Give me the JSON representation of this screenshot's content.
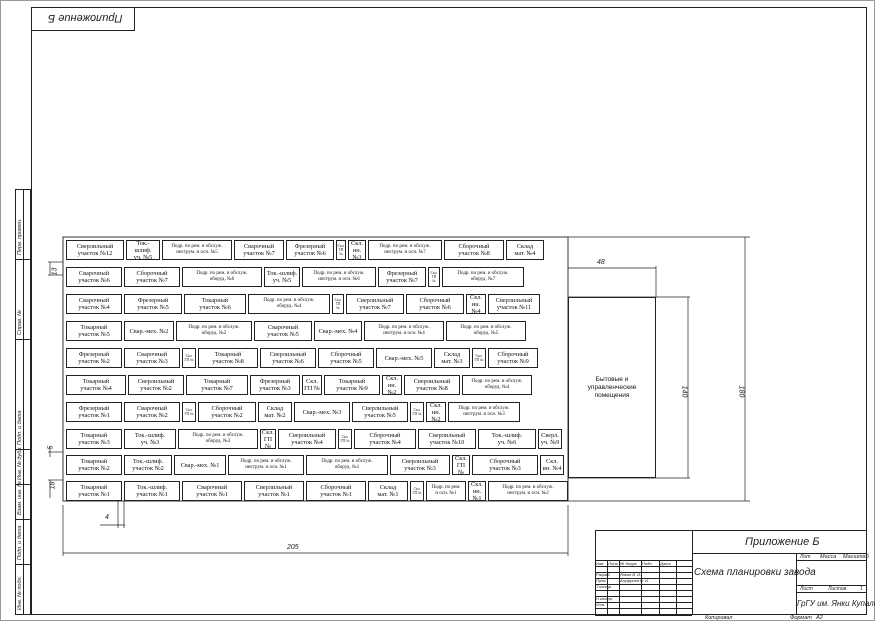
{
  "sheet_header": "Приложение Б",
  "top_stamp": "Приложение Б",
  "title_block": {
    "appendix": "Приложение Б",
    "drawing_title": "Схема планировки завода",
    "organization": "ГрГУ им. Янки Купалы",
    "col_lit": "Лит",
    "col_mass": "Масса",
    "col_scale": "Масштаб",
    "sheet": "Лист",
    "sheets": "Листов",
    "sheets_value": "1",
    "copied": "Копировал",
    "format": "Формат",
    "format_value": "А2",
    "change_headers": [
      "Изм",
      "Лист",
      "№ докум.",
      "Подп.",
      "Дата"
    ],
    "roles": [
      "Разраб.",
      "Пров.",
      "Т.контр.",
      "",
      "Н.контр.",
      "Утв."
    ],
    "people": [
      "Янкин В. И.",
      "Ануфриев В. И."
    ]
  },
  "side_stamp": [
    "Перв. примен.",
    "Справ. №",
    "Подп. и дата",
    "Инв. № дубл.",
    "Взам. инв. №",
    "Подп. и дата",
    "Инв. № подл."
  ],
  "dimensions": {
    "total_width": "205",
    "right_width": "48",
    "height_inner": "140",
    "height_outer": "180",
    "row_height": "13",
    "cell_gap": "4",
    "small_gap": "5",
    "bottom_row": "18"
  },
  "side_building": "Бытовые и\nуправленческие\nпомещения",
  "rows": [
    [
      "Сверлильный\nучасток №12",
      "Ток.-шлиф.\nуч. №5",
      "Подр. по рем. и обслуж.\nинструм. и осн. №5",
      "Сварочный\nучасток №7",
      "Фрезерный\nучасток №6",
      "Скл.\nГП №",
      "Скл.\nин. №3",
      "Подр. по рем. и обслуж.\nинструм. и осн. №7",
      "Сборочный\nучасток №8",
      "Склад\nмат. №4"
    ],
    [
      "Сварочный\nучасток №6",
      "Сборочный\nучасток №7",
      "Подр. по рем. и обслуж.\nоборуд. №6",
      "Ток.-шлиф.\nуч. №5",
      "Подр. по рем. и обслуж.\nинструм. и осн. №6",
      "Фрезерный\nучасток №7",
      "Скл.\nГП №",
      "Подр. по рем. и обслуж.\nоборуд. №7"
    ],
    [
      "Сварочный\nучасток №4",
      "Фрезерный\nучасток №5",
      "Токарный\nучасток №6",
      "Подр. по рем. и обслуж.\nоборуд. №4",
      "Скл.\nГП №",
      "Сверлильный\nучасток №7",
      "Сборочный\nучасток №6",
      "Скл.\nин. №4",
      "Сверлильный\nучасток №11"
    ],
    [
      "Токарный\nучасток №5",
      "Свар.-мех. №2",
      "Подр. по рем. и обслуж.\nоборуд. №2",
      "Сварочный\nучасток №5",
      "Свар.-мех. №4",
      "Подр. по рем. и обслуж.\nинструм. и осн. №4",
      "Подр. по рем. и обслуж.\nоборуд. №5"
    ],
    [
      "Фрезерный\nучасток №2",
      "Сварочный\nучасток №3",
      "Скл.\nГП №",
      "Токарный\nучасток №8",
      "Сверлильный\nучасток №6",
      "Сборочный\nучасток №5",
      "Свар.-мех. №5",
      "Склад\nмат. №3",
      "Скл.\nГП №",
      "Сборочный\nучасток №9"
    ],
    [
      "Токарный\nучасток №4",
      "Сверлильный\nучасток №2",
      "Токарный\nучасток №7",
      "Фрезерный\nучасток №3",
      "Скл.\nГП №",
      "Токарный\nучасток №9",
      "Скл.\nин. №2",
      "Сверлильный\nучасток №8",
      "Подр. по рем. и обслуж.\nоборуд. №4"
    ],
    [
      "Фрезерный\nучасток №1",
      "Сварочный\nучасток №2",
      "Скл.\nГП №",
      "Сборочный\nучасток №2",
      "Склад\nмат. №2",
      "Свар.-мех. №3",
      "Сверлильный\nучасток №5",
      "Скл.\nГП №",
      "Скл.\nин. №2",
      "Подр. по рем. и обслуж.\nинструм. и осн. №3"
    ],
    [
      "Токарный\nучасток №3",
      "Ток.-шлиф.\nуч. №3",
      "Подр. по рем. и обслуж.\nоборуд. №3",
      "Скл.\nГП №",
      "Сверлильный\nучасток №4",
      "Скл.\nГП №",
      "Сборочный\nучасток №4",
      "Сверлильный\nучасток №10",
      "Ток.-шлиф.\nуч. №6",
      "Сверл.\nуч. №9"
    ],
    [
      "Токарный\nучасток №2",
      "Ток.-шлиф.\nучасток №2",
      "Свар.-мех. №1",
      "Подр. по рем. и обслуж.\nинструм. и осн. №1",
      "Подр. по рем. и обслуж.\nоборуд. №1",
      "Сверлильный\nучасток №3",
      "Скл.\nГП №",
      "Сборочный\nучасток №3",
      "Скл.\nин. №4"
    ],
    [
      "Токарный\nучасток №1",
      "Ток.-шлиф.\nучасток №1",
      "Сварочный\nучасток №1",
      "Сверлильный\nучасток №1",
      "Сборочный\nучасток №1",
      "Склад\nмат. №1",
      "Скл.\nГП №",
      "Подр. по рем.\nи осн. №1",
      "Скл.\nин. №1",
      "Подр. по рем. и обслуж.\nинструм. и осн. №2"
    ]
  ]
}
